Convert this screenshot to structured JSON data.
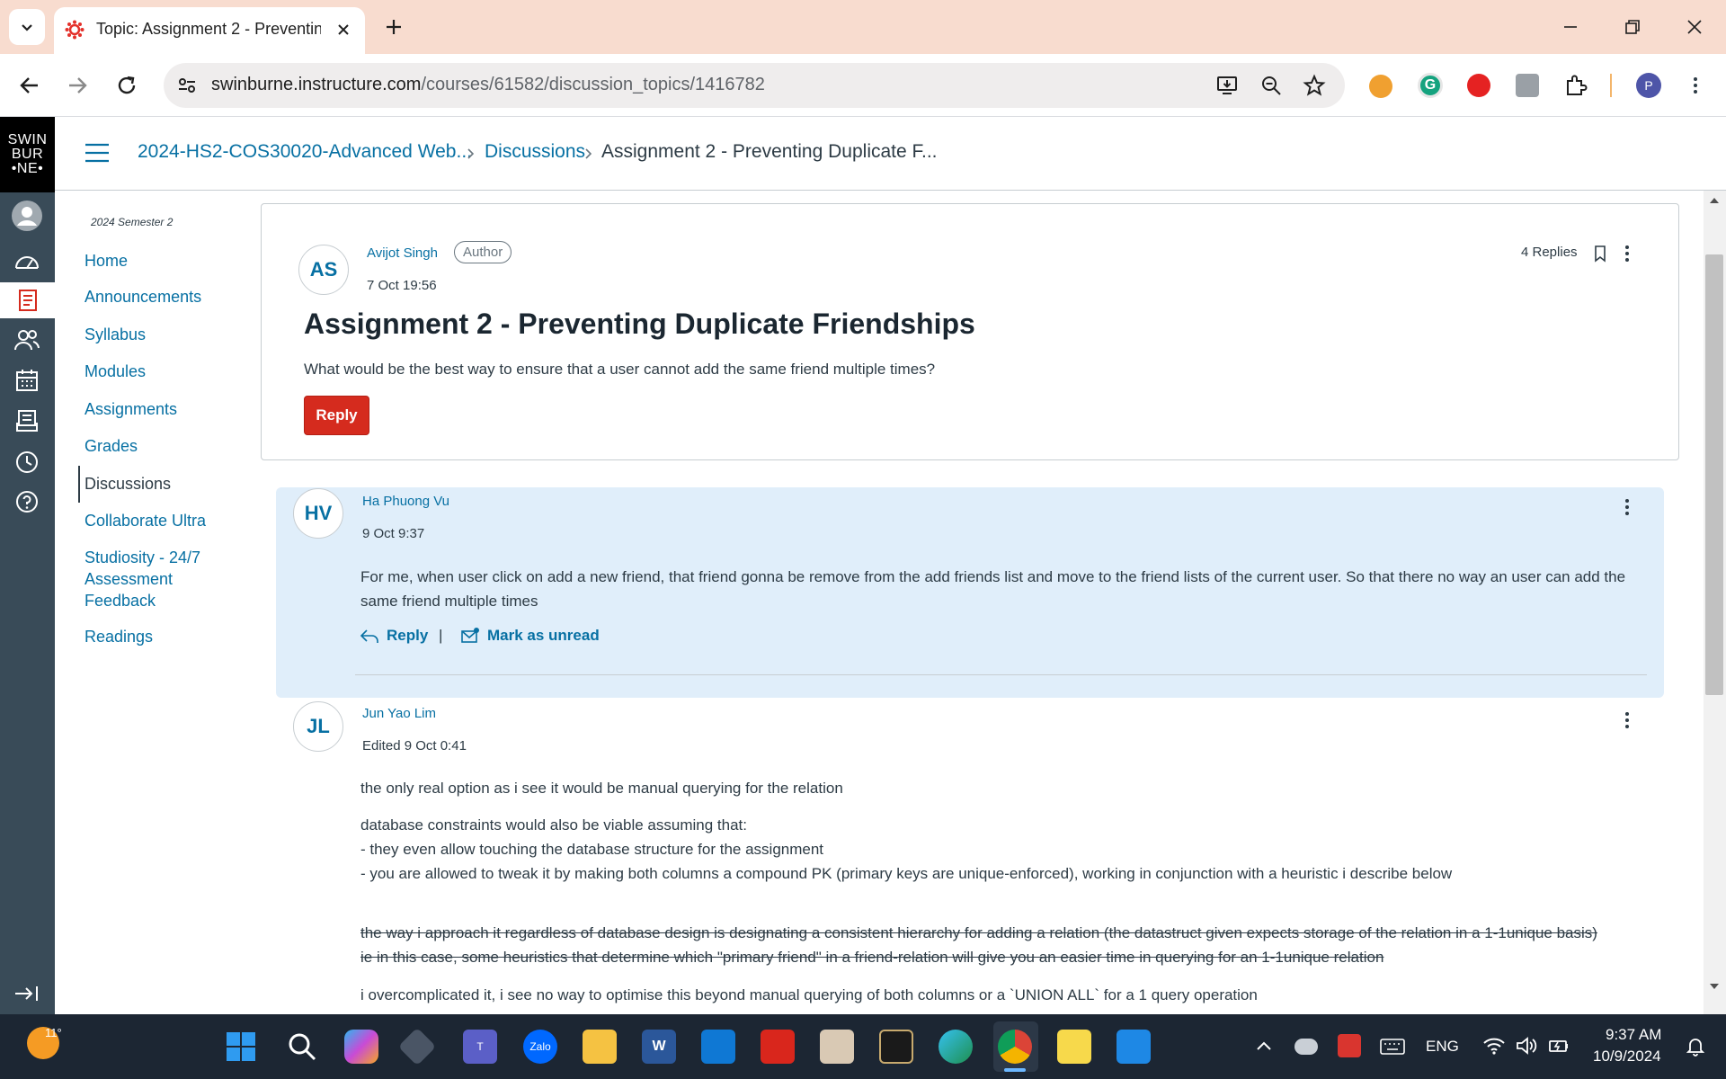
{
  "browser": {
    "tab_title": "Topic: Assignment 2 - Preventin",
    "url_host": "swinburne.instructure.com",
    "url_path": "/courses/61582/discussion_topics/1416782",
    "profile_initial": "P"
  },
  "logo_text": "SWIN BUR •NE•",
  "breadcrumb": {
    "course": "2024-HS2-COS30020-Advanced Web...",
    "section": "Discussions",
    "current": "Assignment 2 - Preventing Duplicate F..."
  },
  "course_nav": {
    "term": "2024 Semester 2",
    "items": [
      {
        "label": "Home"
      },
      {
        "label": "Announcements"
      },
      {
        "label": "Syllabus"
      },
      {
        "label": "Modules"
      },
      {
        "label": "Assignments"
      },
      {
        "label": "Grades"
      },
      {
        "label": "Discussions",
        "active": true
      },
      {
        "label": "Collaborate Ultra"
      },
      {
        "label": "Studiosity - 24/7 Assessment Feedback"
      },
      {
        "label": "Readings"
      }
    ]
  },
  "topic": {
    "initials": "AS",
    "author": "Avijot Singh",
    "role_badge": "Author",
    "date": "7 Oct 19:56",
    "replies": "4 Replies",
    "title": "Assignment 2 - Preventing Duplicate Friendships",
    "message": "What would be the best way to ensure that a user cannot add the same friend multiple times?",
    "reply_label": "Reply"
  },
  "replies": [
    {
      "initials": "HV",
      "author": "Ha Phuong Vu",
      "date": "9 Oct 9:37",
      "body": "For me, when user click on add a new friend, that friend gonna be remove from the add friends list and move to the friend lists of the current user. So that there no way an user can add the same friend multiple times",
      "reply_label": "Reply",
      "separator": "|",
      "mark_label": "Mark as unread"
    },
    {
      "initials": "JL",
      "author": "Jun Yao Lim",
      "date": "Edited 9 Oct 0:41",
      "p1": "the only real option as i see it would be manual querying for the relation",
      "p2a": "database constraints would also be viable assuming that:",
      "p2b": "- they even allow touching the database structure for the assignment",
      "p2c": "- you are allowed to tweak it by making both columns a compound PK (primary keys are unique-enforced), working in conjunction with a heuristic i describe below",
      "strike1": "the way i approach it regardless of database design is designating a consistent hierarchy for adding a relation (the datastruct given expects storage of the relation in a 1-1unique basis)",
      "strike2": "ie in this case, some heuristics that determine which \"primary friend\" in a friend-relation will give you an easier time in querying for an 1-1unique relation",
      "p3": "i overcomplicated it, i see no way to optimise this beyond manual querying of both columns or a `UNION ALL` for a 1 query operation"
    }
  ],
  "taskbar": {
    "weather": "11°",
    "lang": "ENG",
    "time": "9:37 AM",
    "date": "10/9/2024",
    "zalo": "Zalo",
    "word": "W"
  },
  "colors": {
    "link": "#0770a3",
    "reply_button": "#d52b1e",
    "highlight": "#e0eefa",
    "global_nav": "#394b58"
  }
}
